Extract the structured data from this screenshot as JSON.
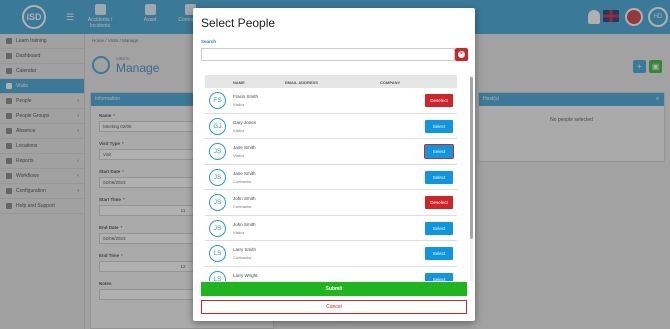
{
  "topbar": {
    "logo": "iSD",
    "nav": [
      {
        "label": "Accidents / Incidents"
      },
      {
        "label": "Asset"
      },
      {
        "label": "Contractor"
      }
    ],
    "user_initials": "HD"
  },
  "sidebar": {
    "items": [
      {
        "label": "Learn training",
        "icon": "book-icon"
      },
      {
        "label": "Dashboard",
        "icon": "dashboard-icon"
      },
      {
        "label": "Calendar",
        "icon": "calendar-icon"
      },
      {
        "label": "Visits",
        "icon": "visits-icon",
        "active": true
      },
      {
        "label": "People",
        "icon": "person-icon",
        "chevron": "‹"
      },
      {
        "label": "People Groups",
        "icon": "group-icon",
        "chevron": "‹"
      },
      {
        "label": "Absence",
        "icon": "absence-icon",
        "chevron": "‹"
      },
      {
        "label": "Locations",
        "icon": "location-icon"
      },
      {
        "label": "Reports",
        "icon": "report-icon",
        "chevron": "‹"
      },
      {
        "label": "Workflows",
        "icon": "workflow-icon",
        "chevron": "‹"
      },
      {
        "label": "Configuration",
        "icon": "config-icon",
        "chevron": "‹"
      },
      {
        "label": "Help and Support",
        "icon": "help-icon"
      }
    ]
  },
  "page": {
    "breadcrumb": "Home / Visits / Manage",
    "pre_title": "VISITS",
    "title": "Manage",
    "info_panel_title": "Information",
    "hosts_panel_title": "Host(s)",
    "hosts_empty": "No people selected",
    "fields": [
      {
        "label": "Name",
        "required": true,
        "value": "Meeting 02/06"
      },
      {
        "label": "Visit Type",
        "required": true,
        "value": "Visit"
      },
      {
        "label": "Start Date",
        "required": true,
        "value": "02/06/2023"
      },
      {
        "label": "Start Time",
        "required": true,
        "value": "11"
      },
      {
        "label": "End Date",
        "required": true,
        "value": "02/06/2023"
      },
      {
        "label": "End Time",
        "required": true,
        "value": "12"
      },
      {
        "label": "Notes",
        "required": false,
        "value": ""
      }
    ]
  },
  "modal": {
    "title": "Select People",
    "search_label": "Search",
    "search_value": "",
    "search_placeholder": "",
    "columns": [
      "NAME",
      "EMAIL ADDRESS",
      "COMPANY"
    ],
    "people": [
      {
        "initials": "FS",
        "name": "Fracis Smith",
        "role": "Visitor",
        "action": "Deselect",
        "selected": true
      },
      {
        "initials": "GJ",
        "name": "Gary Jones",
        "role": "Visitor",
        "action": "Select",
        "selected": false
      },
      {
        "initials": "JS",
        "name": "Jane Smith",
        "role": "Visitor",
        "action": "Select",
        "selected": false,
        "focused": true
      },
      {
        "initials": "JS",
        "name": "Jane Smith",
        "role": "Contractor",
        "action": "Select",
        "selected": false
      },
      {
        "initials": "JS",
        "name": "John Smith",
        "role": "Contractor",
        "action": "Deselect",
        "selected": true
      },
      {
        "initials": "JS",
        "name": "John Smith",
        "role": "Visitor",
        "action": "Select",
        "selected": false
      },
      {
        "initials": "LS",
        "name": "Larry Smith",
        "role": "Contractor",
        "action": "Select",
        "selected": false
      },
      {
        "initials": "LS",
        "name": "Larry Wright",
        "role": "",
        "action": "Select",
        "selected": false
      }
    ],
    "submit_label": "Submit",
    "cancel_label": "Cancel"
  },
  "colors": {
    "accent": "#2b9bd6",
    "select": "#0f96e0",
    "deselect": "#d2232a",
    "submit": "#1fb51f"
  }
}
